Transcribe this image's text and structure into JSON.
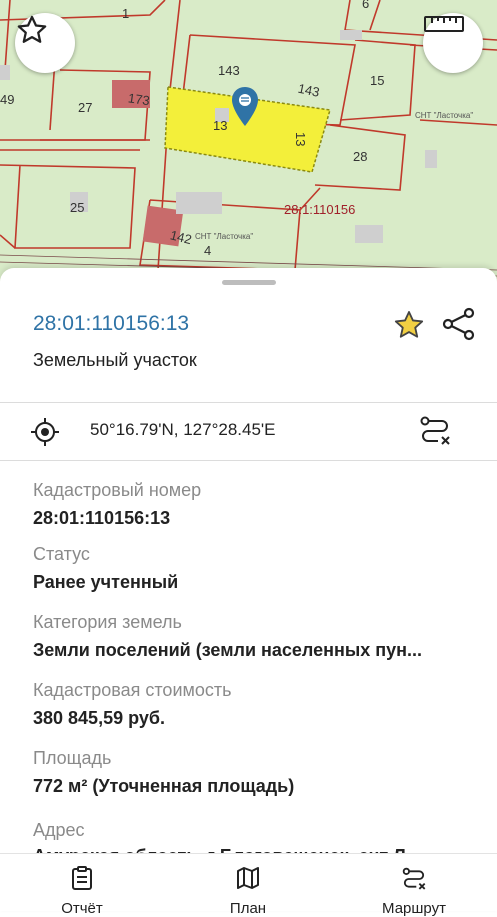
{
  "map": {
    "parcel_labels": [
      "1",
      "6",
      "143",
      "15",
      "49",
      "27",
      "173",
      "143",
      "13",
      "13",
      "28",
      "25",
      "142",
      "4",
      "28:1:110156",
      "СНТ \"Ласточка\"",
      "СНТ \"Ласточка\""
    ],
    "favorite_icon": "star-outline-icon",
    "ruler_icon": "ruler-icon",
    "marker_icon": "map-pin-icon"
  },
  "parcel": {
    "cadastral_title": "28:01:110156:13",
    "type": "Земельный участок",
    "coordinates": "50°16.79'N, 127°28.45'E"
  },
  "fields": [
    {
      "label": "Кадастровый номер",
      "value": "28:01:110156:13"
    },
    {
      "label": "Статус",
      "value": "Ранее учтенный"
    },
    {
      "label": "Категория земель",
      "value": "Земли поселений (земли населенных пун..."
    },
    {
      "label": "Кадастровая стоимость",
      "value": "380 845,59 руб."
    },
    {
      "label": "Площадь",
      "value": "772 м² (Уточненная площадь)"
    },
    {
      "label": "Адрес",
      "value": "Амурская область, г Благовещенск, снт Л..."
    }
  ],
  "nav": {
    "report": "Отчёт",
    "plan": "План",
    "route": "Маршрут"
  },
  "colors": {
    "accent": "#2f73a6",
    "star": "#e0b62a",
    "parcel_highlight": "#f3ef3a",
    "boundary": "#c0392b"
  }
}
